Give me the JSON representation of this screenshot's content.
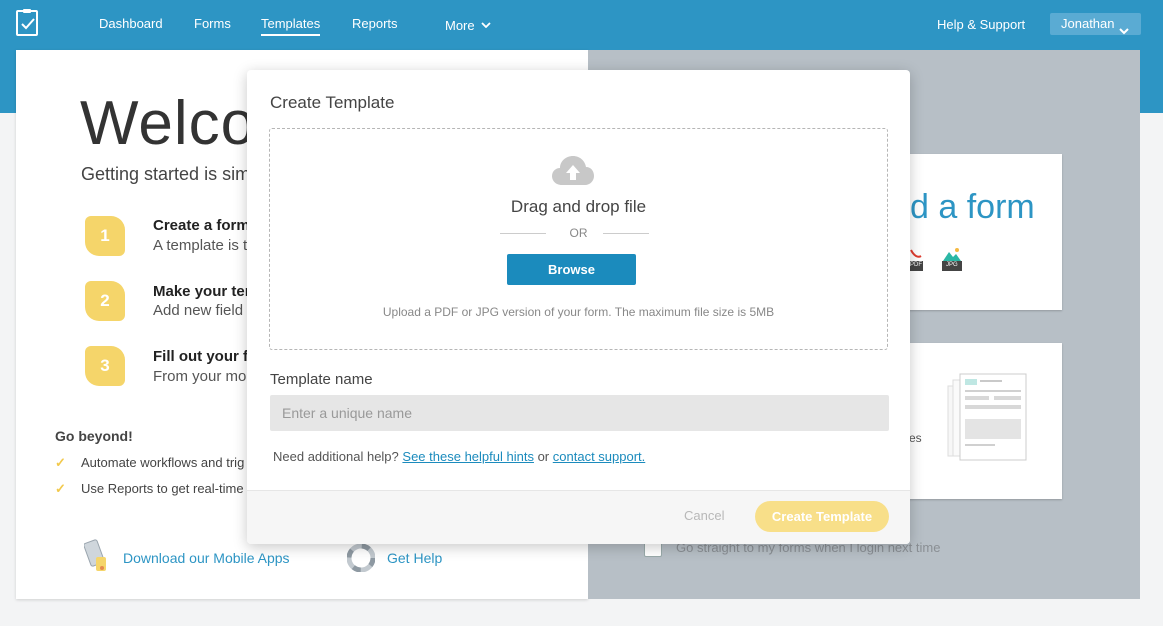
{
  "nav": {
    "items": [
      {
        "label": "Dashboard"
      },
      {
        "label": "Forms"
      },
      {
        "label": "Templates"
      },
      {
        "label": "Reports"
      },
      {
        "label": "More"
      }
    ],
    "help": "Help & Support",
    "user": "Jonathan"
  },
  "welcome": {
    "title": "Welco",
    "subtitle": "Getting started is sim",
    "steps": [
      {
        "number": "1",
        "title": "Create a form",
        "desc": "A template is t"
      },
      {
        "number": "2",
        "title": "Make your ter",
        "desc": "Add new field"
      },
      {
        "number": "3",
        "title": "Fill out your f",
        "desc": "From your mol"
      }
    ],
    "beyond_title": "Go beyond!",
    "beyond_items": [
      {
        "label": "Automate workflows and trig"
      },
      {
        "label": "Use Reports to get real-time"
      }
    ],
    "mobile_link": "Download our Mobile Apps",
    "help_link": "Get Help"
  },
  "right_panel": {
    "heading": "d a form",
    "pdf_label": "PDF",
    "jpg_label": "JPG",
    "card2_text": "es",
    "checkbox_label": "Go straight to my forms when I login next time"
  },
  "modal": {
    "title": "Create Template",
    "drop_label": "Drag and drop file",
    "or": "OR",
    "browse": "Browse",
    "hint": "Upload a PDF or JPG version of your form. The maximum file size is 5MB",
    "name_label": "Template name",
    "name_placeholder": "Enter a unique name",
    "help_prefix": "Need additional help?",
    "hints_link": "See these helpful hints",
    "help_or": "or",
    "support_link": "contact support.",
    "cancel": "Cancel",
    "create": "Create Template"
  },
  "colors": {
    "brand": "#2d95c4",
    "accent_yellow": "#f5d56a",
    "browse_button": "#1b8bbd"
  }
}
